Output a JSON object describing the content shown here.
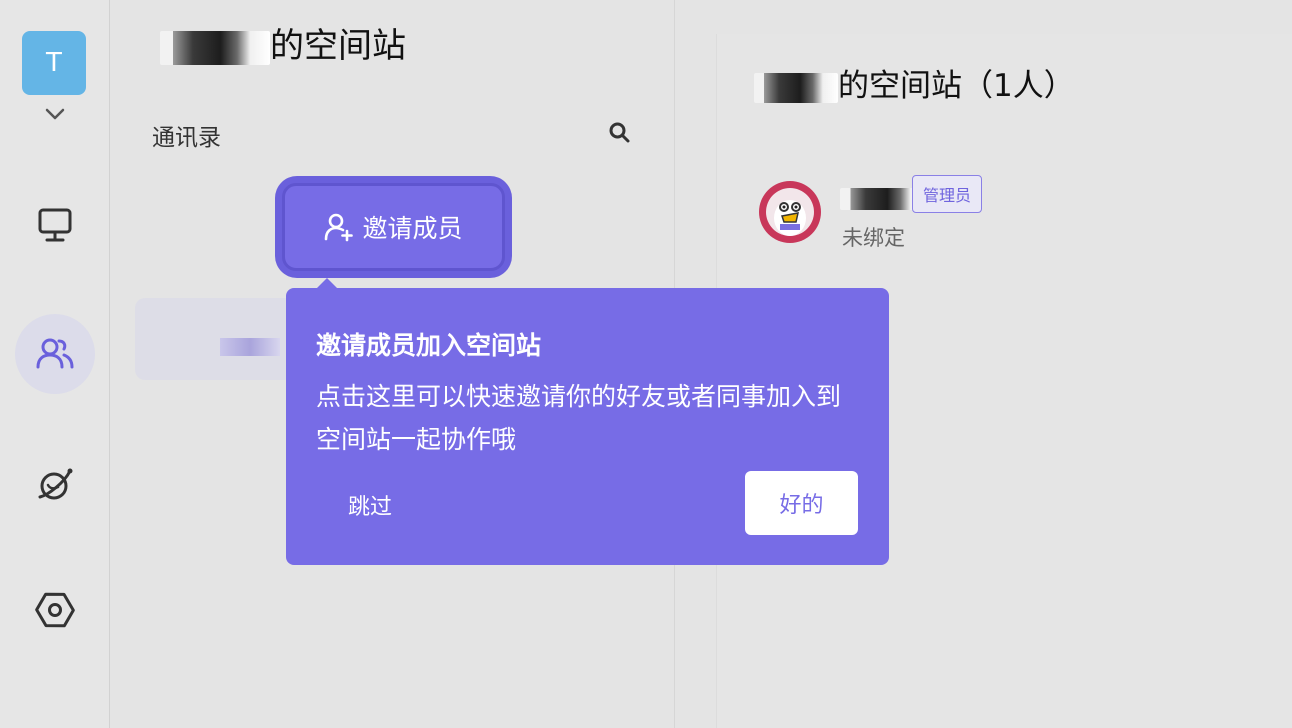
{
  "colors": {
    "accent": "#776ce6",
    "avatar_bg": "#64b5e6",
    "background": "#e4e4e4"
  },
  "workspace": {
    "avatar_letter": "T",
    "title_suffix": "的空间站"
  },
  "rail": {
    "items": [
      {
        "icon": "desktop-icon"
      },
      {
        "icon": "users-icon",
        "active": true
      },
      {
        "icon": "planet-icon"
      },
      {
        "icon": "settings-icon"
      }
    ]
  },
  "contacts": {
    "label": "通讯录",
    "invite_button_label": "邀请成员"
  },
  "right_panel": {
    "title_suffix": "的空间站（1人）",
    "member": {
      "role_badge": "管理员",
      "status": "未绑定"
    }
  },
  "popover": {
    "title": "邀请成员加入空间站",
    "body": "点击这里可以快速邀请你的好友或者同事加入到空间站一起协作哦",
    "skip_label": "跳过",
    "ok_label": "好的"
  }
}
